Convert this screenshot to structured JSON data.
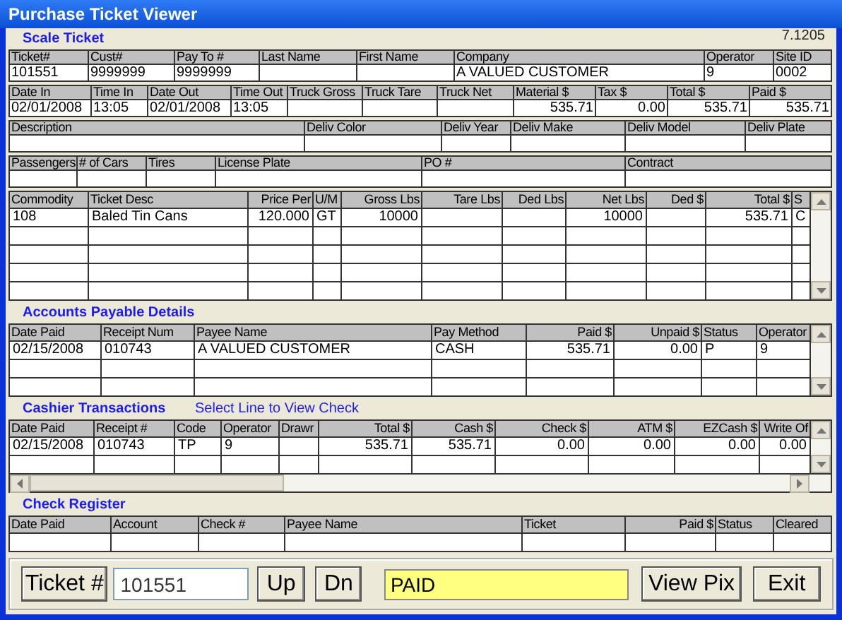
{
  "window": {
    "title": "Purchase Ticket Viewer"
  },
  "version": "7.1205",
  "scale_ticket": {
    "title": "Scale Ticket",
    "field_rows": [
      [
        {
          "label": "Ticket#",
          "value": "101551",
          "kind": "text"
        },
        {
          "label": "Cust#",
          "value": "9999999",
          "kind": "text"
        },
        {
          "label": "Pay To #",
          "value": "9999999",
          "kind": "text"
        },
        {
          "label": "Last Name",
          "kind": "text"
        },
        {
          "label": "First Name",
          "kind": "text"
        },
        {
          "label": "Company",
          "value": "A VALUED CUSTOMER",
          "kind": "text"
        },
        {
          "label": "Operator",
          "value": "9",
          "kind": "text"
        },
        {
          "label": "Site ID",
          "value": "0002",
          "kind": "text"
        }
      ],
      [
        {
          "label": "Date In",
          "value": "02/01/2008",
          "kind": "text"
        },
        {
          "label": "Time In",
          "value": "13:05",
          "kind": "text"
        },
        {
          "label": "Date Out",
          "value": "02/01/2008",
          "kind": "text"
        },
        {
          "label": "Time Out",
          "value": "13:05",
          "kind": "text"
        },
        {
          "label": "Truck Gross",
          "kind": "text"
        },
        {
          "label": "Truck Tare",
          "kind": "text"
        },
        {
          "label": "Truck Net",
          "kind": "text"
        },
        {
          "label": "Material $",
          "value": "535.71",
          "kind": "number"
        },
        {
          "label": "Tax $",
          "value": "0.00",
          "kind": "number"
        },
        {
          "label": "Total $",
          "value": "535.71",
          "kind": "number"
        },
        {
          "label": "Paid $",
          "value": "535.71",
          "kind": "number"
        }
      ],
      [
        {
          "label": "Description",
          "kind": "text"
        },
        {
          "label": "Deliv Color",
          "kind": "text"
        },
        {
          "label": "Deliv Year",
          "kind": "text"
        },
        {
          "label": "Deliv Make",
          "kind": "text"
        },
        {
          "label": "Deliv Model",
          "kind": "text"
        },
        {
          "label": "Deliv Plate",
          "kind": "text"
        }
      ],
      [
        {
          "label": "Passengers",
          "kind": "text"
        },
        {
          "label": "# of Cars",
          "kind": "text"
        },
        {
          "label": "Tires",
          "kind": "text"
        },
        {
          "label": "License Plate",
          "kind": "text"
        },
        {
          "label": "PO #",
          "kind": "text"
        },
        {
          "label": "Contract",
          "kind": "text"
        }
      ]
    ],
    "items": {
      "columns": [
        {
          "label": "Commodity",
          "kind": "text"
        },
        {
          "label": "Ticket Desc",
          "kind": "text"
        },
        {
          "label": "Price Per",
          "kind": "number"
        },
        {
          "label": "U/M",
          "kind": "text"
        },
        {
          "label": "Gross Lbs",
          "kind": "number"
        },
        {
          "label": "Tare Lbs",
          "kind": "number"
        },
        {
          "label": "Ded Lbs",
          "kind": "number"
        },
        {
          "label": "Net Lbs",
          "kind": "number"
        },
        {
          "label": "Ded $",
          "kind": "number"
        },
        {
          "label": "Total $",
          "kind": "number"
        },
        {
          "label": "S",
          "kind": "text"
        }
      ],
      "rows": [
        [
          "108",
          "Baled Tin Cans",
          "120.000",
          "GT",
          "10000",
          null,
          null,
          "10000",
          null,
          "535.71",
          "C"
        ]
      ]
    }
  },
  "accounts_payable": {
    "title": "Accounts Payable Details",
    "columns": [
      {
        "label": "Date Paid",
        "kind": "text"
      },
      {
        "label": "Receipt Num",
        "kind": "text"
      },
      {
        "label": "Payee Name",
        "kind": "text"
      },
      {
        "label": "Pay Method",
        "kind": "text"
      },
      {
        "label": "Paid $",
        "kind": "number"
      },
      {
        "label": "Unpaid  $",
        "kind": "number"
      },
      {
        "label": "Status",
        "kind": "text"
      },
      {
        "label": "Operator",
        "kind": "text"
      }
    ],
    "rows": [
      [
        "02/15/2008",
        "010743",
        "A VALUED CUSTOMER",
        "CASH",
        "535.71",
        "0.00",
        "P",
        "9"
      ]
    ]
  },
  "cashier_transactions": {
    "title": "Cashier Transactions",
    "link": "Select Line to View Check",
    "columns": [
      {
        "label": "Date Paid",
        "kind": "text"
      },
      {
        "label": "Receipt #",
        "kind": "text"
      },
      {
        "label": "Code",
        "kind": "text"
      },
      {
        "label": "Operator",
        "kind": "text"
      },
      {
        "label": "Drawr",
        "kind": "text"
      },
      {
        "label": "Total $",
        "kind": "number"
      },
      {
        "label": "Cash $",
        "kind": "number"
      },
      {
        "label": "Check $",
        "kind": "number"
      },
      {
        "label": "ATM $",
        "kind": "number"
      },
      {
        "label": "EZCash $",
        "kind": "number"
      },
      {
        "label": "Write Of",
        "kind": "number"
      }
    ],
    "rows": [
      [
        "02/15/2008",
        "010743",
        "TP",
        "9",
        null,
        "535.71",
        "535.71",
        "0.00",
        "0.00",
        "0.00",
        "0.00"
      ]
    ]
  },
  "check_register": {
    "title": "Check Register",
    "columns": [
      {
        "label": "Date Paid",
        "kind": "text"
      },
      {
        "label": "Account",
        "kind": "text"
      },
      {
        "label": "Check #",
        "kind": "text"
      },
      {
        "label": "Payee Name",
        "kind": "text"
      },
      {
        "label": "Ticket",
        "kind": "text"
      },
      {
        "label": "Paid $",
        "kind": "number"
      },
      {
        "label": "Status",
        "kind": "text"
      },
      {
        "label": "Cleared",
        "kind": "text"
      }
    ]
  },
  "footer": {
    "ticket_button": "Ticket #",
    "ticket_input": "101551",
    "up_button": "Up",
    "down_button": "Dn",
    "status": "PAID",
    "view_pix_button": "View Pix",
    "exit_button": "Exit"
  }
}
